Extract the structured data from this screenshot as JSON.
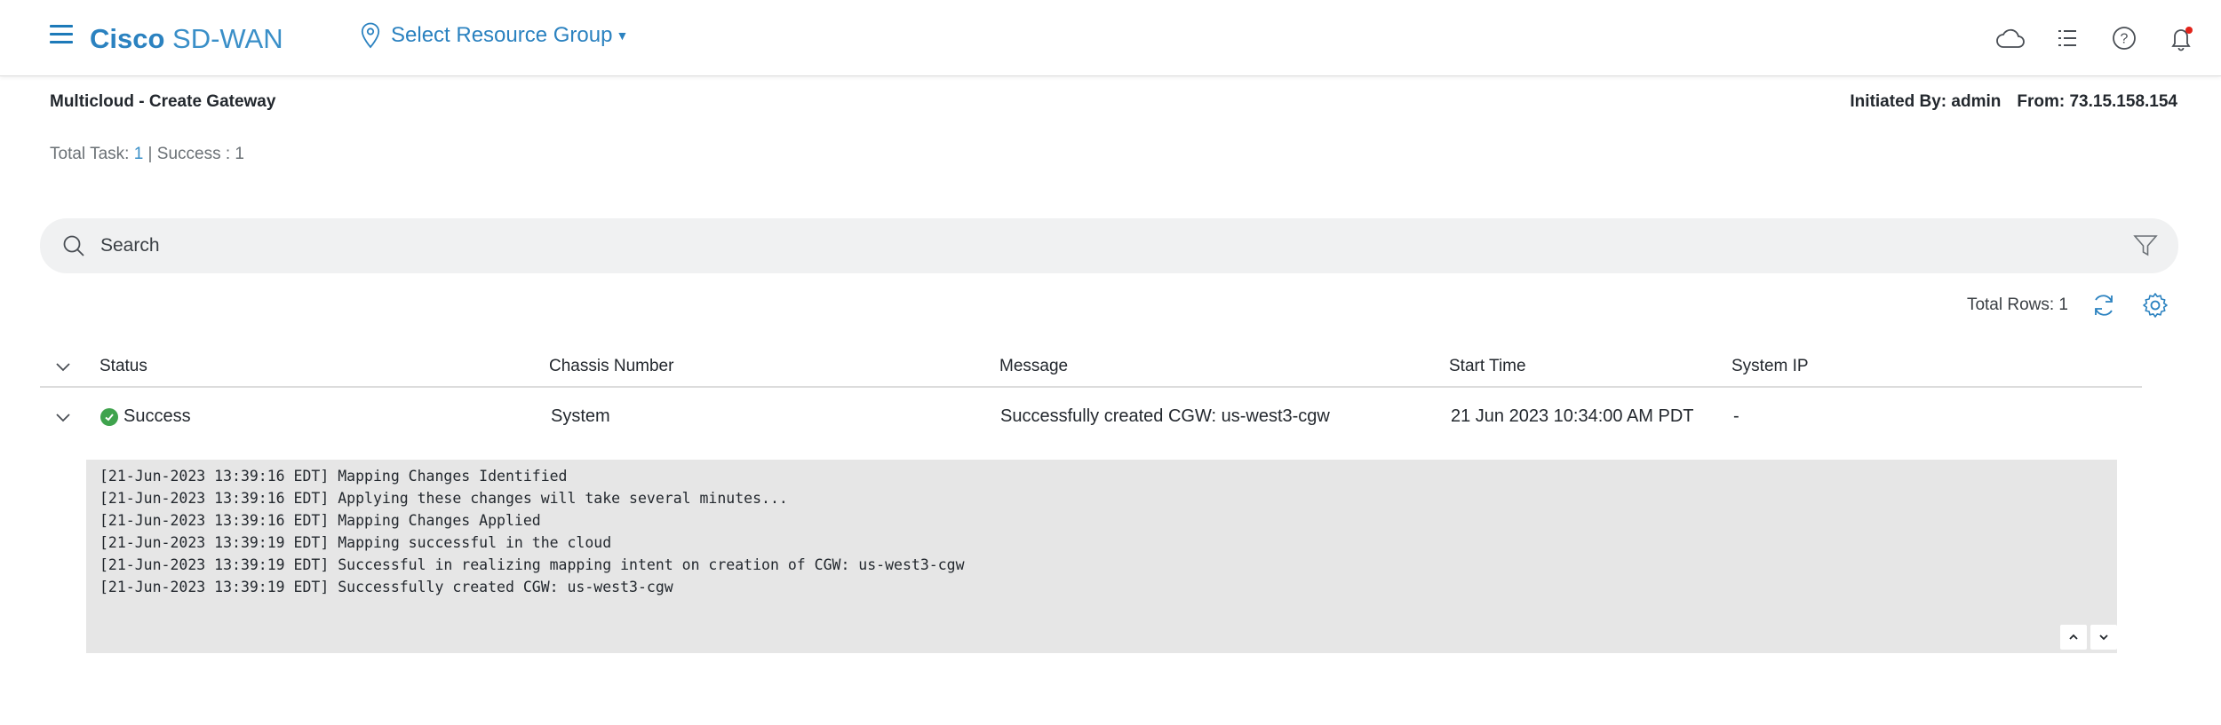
{
  "header": {
    "brand_bold": "Cisco",
    "brand_rest": "SD-WAN",
    "resource_group_label": "Select Resource Group",
    "icons": [
      "menu-icon",
      "location-pin-icon",
      "cloud-icon",
      "list-icon",
      "help-icon",
      "bell-icon"
    ]
  },
  "page": {
    "title": "Multicloud - Create Gateway",
    "initiated_by": "Initiated By: admin",
    "from": "From: 73.15.158.154",
    "totals_prefix": "Total Task: ",
    "total_task": "1",
    "totals_sep": " | Success : ",
    "success_count": "1"
  },
  "search": {
    "placeholder": "Search"
  },
  "table": {
    "total_rows": "Total Rows: 1",
    "columns": [
      "Status",
      "Chassis Number",
      "Message",
      "Start Time",
      "System IP"
    ],
    "rows": [
      {
        "status": "Success",
        "chassis": "System",
        "message": "Successfully created CGW: us-west3-cgw",
        "start_time": "21 Jun 2023 10:34:00 AM PDT",
        "system_ip": "-"
      }
    ]
  },
  "log": {
    "lines": "[21-Jun-2023 13:39:16 EDT] Mapping Changes Identified\n[21-Jun-2023 13:39:16 EDT] Applying these changes will take several minutes...\n[21-Jun-2023 13:39:16 EDT] Mapping Changes Applied\n[21-Jun-2023 13:39:19 EDT] Mapping successful in the cloud\n[21-Jun-2023 13:39:19 EDT] Successful in realizing mapping intent on creation of CGW: us-west3-cgw\n[21-Jun-2023 13:39:19 EDT] Successfully created CGW: us-west3-cgw"
  },
  "colors": {
    "brand_blue": "#2b82c0",
    "success_green": "#3fa34d",
    "notification_red": "#e2231a"
  }
}
